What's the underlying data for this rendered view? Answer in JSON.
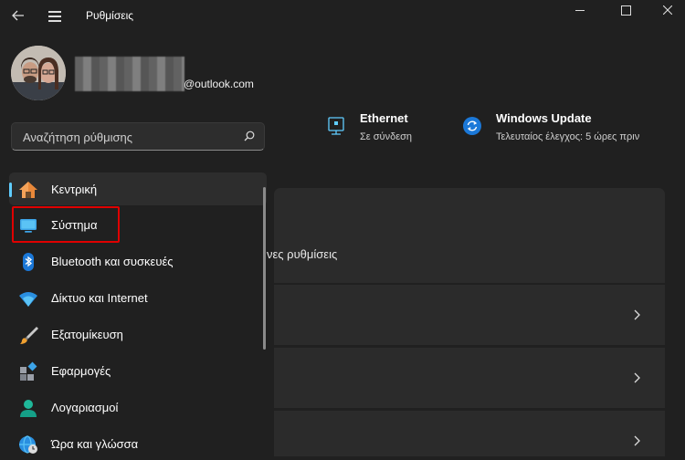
{
  "app": {
    "title": "Ρυθμίσεις"
  },
  "profile": {
    "email_suffix": "@outlook.com"
  },
  "search": {
    "placeholder": "Αναζήτηση ρύθμισης"
  },
  "nav": {
    "items": [
      {
        "label": "Κεντρική",
        "icon": "home-icon",
        "selected": true
      },
      {
        "label": "Σύστημα",
        "icon": "system-display-icon",
        "highlighted": true
      },
      {
        "label": "Bluetooth και συσκευές",
        "icon": "bluetooth-icon"
      },
      {
        "label": "Δίκτυο και Internet",
        "icon": "wifi-icon"
      },
      {
        "label": "Εξατομίκευση",
        "icon": "brush-icon"
      },
      {
        "label": "Εφαρμογές",
        "icon": "apps-icon"
      },
      {
        "label": "Λογαριασμοί",
        "icon": "account-icon"
      },
      {
        "label": "Ώρα και γλώσσα",
        "icon": "globe-clock-icon"
      }
    ]
  },
  "status": {
    "ethernet": {
      "title": "Ethernet",
      "subtitle": "Σε σύνδεση"
    },
    "windows_update": {
      "title": "Windows Update",
      "subtitle": "Τελευταίος έλεγχος: 5 ώρες πριν"
    }
  },
  "main": {
    "partial_text": "νες ρυθμίσεις"
  },
  "colors": {
    "background": "#202020",
    "accent": "#60cdff",
    "highlight_border": "#e00000",
    "card": "#2b2b2b"
  }
}
